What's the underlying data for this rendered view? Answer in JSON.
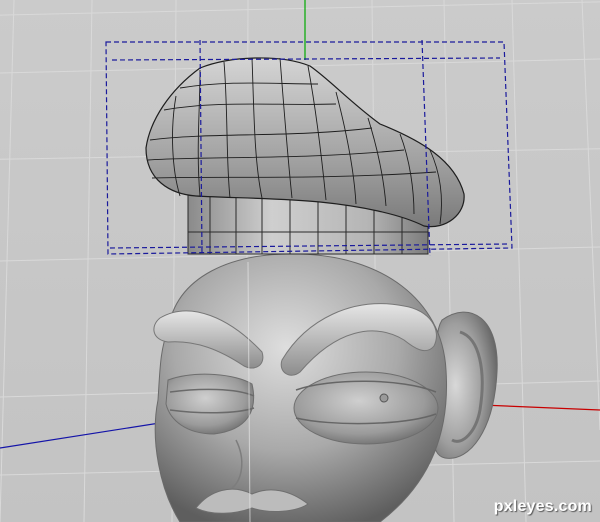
{
  "watermark": {
    "text": "pxleyes.com"
  },
  "colors": {
    "background": "#c6c6c6",
    "grid": "#d8d8d8",
    "axis_y": "#00aa00",
    "axis_x": "#c80000",
    "axis_z": "#1010a0",
    "bounding_box": "#1a1a9c",
    "wireframe": "#1b1b1b",
    "mesh_surface": "#a9a9a9"
  },
  "icons": [
    "y-axis-line",
    "x-axis-line",
    "z-axis-line",
    "bounding-box-dashed"
  ]
}
